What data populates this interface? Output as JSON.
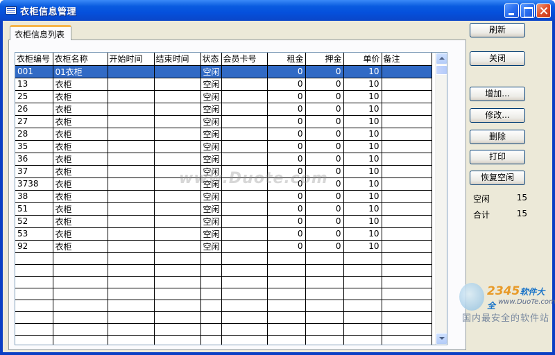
{
  "window": {
    "title": "衣柜信息管理",
    "title_icon": "table-window-icon"
  },
  "tab": {
    "label": "衣柜信息列表"
  },
  "table": {
    "columns": [
      "衣柜编号",
      "衣柜名称",
      "开始时间",
      "结束时间",
      "状态",
      "会员卡号",
      "租金",
      "押金",
      "单价",
      "备注"
    ],
    "rows": [
      [
        "001",
        "01衣柜",
        "",
        "",
        "空闲",
        "",
        "0",
        "0",
        "10",
        ""
      ],
      [
        "13",
        "衣柜",
        "",
        "",
        "空闲",
        "",
        "0",
        "0",
        "10",
        ""
      ],
      [
        "25",
        "衣柜",
        "",
        "",
        "空闲",
        "",
        "0",
        "0",
        "10",
        ""
      ],
      [
        "26",
        "衣柜",
        "",
        "",
        "空闲",
        "",
        "0",
        "0",
        "10",
        ""
      ],
      [
        "27",
        "衣柜",
        "",
        "",
        "空闲",
        "",
        "0",
        "0",
        "10",
        ""
      ],
      [
        "28",
        "衣柜",
        "",
        "",
        "空闲",
        "",
        "0",
        "0",
        "10",
        ""
      ],
      [
        "35",
        "衣柜",
        "",
        "",
        "空闲",
        "",
        "0",
        "0",
        "10",
        ""
      ],
      [
        "36",
        "衣柜",
        "",
        "",
        "空闲",
        "",
        "0",
        "0",
        "10",
        ""
      ],
      [
        "37",
        "衣柜",
        "",
        "",
        "空闲",
        "",
        "0",
        "0",
        "10",
        ""
      ],
      [
        "3738",
        "衣柜",
        "",
        "",
        "空闲",
        "",
        "0",
        "0",
        "10",
        ""
      ],
      [
        "38",
        "衣柜",
        "",
        "",
        "空闲",
        "",
        "0",
        "0",
        "10",
        ""
      ],
      [
        "51",
        "衣柜",
        "",
        "",
        "空闲",
        "",
        "0",
        "0",
        "10",
        ""
      ],
      [
        "52",
        "衣柜",
        "",
        "",
        "空闲",
        "",
        "0",
        "0",
        "10",
        ""
      ],
      [
        "53",
        "衣柜",
        "",
        "",
        "空闲",
        "",
        "0",
        "0",
        "10",
        ""
      ],
      [
        "92",
        "衣柜",
        "",
        "",
        "空闲",
        "",
        "0",
        "0",
        "10",
        ""
      ]
    ],
    "selected_row": 0,
    "empty_rows": 9
  },
  "buttons": {
    "refresh": "刷新",
    "close": "关闭",
    "add": "增加...",
    "edit": "修改...",
    "delete": "删除",
    "print": "打印",
    "restore_idle": "恢复空闲"
  },
  "stats": {
    "idle_label": "空闲",
    "idle_value": "15",
    "total_label": "合计",
    "total_value": "15"
  },
  "watermark": {
    "text": "www.Duote.com",
    "brand": "2345",
    "brand_suffix": "软件大全",
    "url": "www.DuoTe.com",
    "tagline": "国内最安全的软件站"
  },
  "colors": {
    "titlebar": "#0a5ce0",
    "selection": "#316ac5",
    "dialog_bg": "#ece9d8",
    "tab_accent": "#f6b54a"
  }
}
